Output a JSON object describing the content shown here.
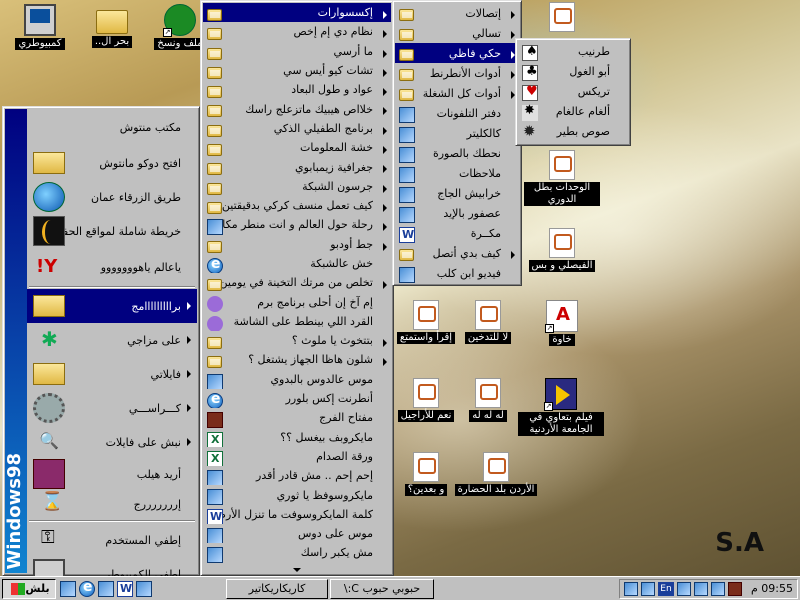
{
  "watermark": "S.A",
  "desktop_icons": [
    {
      "label": "كمبيوطري",
      "icon": "computer-icon"
    },
    {
      "label": "بحر ال..",
      "icon": "folder-icon"
    },
    {
      "label": "ملف ونسخ",
      "icon": "green-ball-icon"
    },
    {
      "label": "الوحدات بطل الدوري",
      "icon": "document-icon"
    },
    {
      "label": "الفيصلي و بس",
      "icon": "document-icon"
    },
    {
      "label": "إقرأ واستمتع",
      "icon": "document-icon"
    },
    {
      "label": "لا للتدخين",
      "icon": "document-icon"
    },
    {
      "label": "خاوة",
      "icon": "acrobat-icon"
    },
    {
      "label": "نعم للأراجيل",
      "icon": "document-icon"
    },
    {
      "label": "له له له",
      "icon": "document-icon"
    },
    {
      "label": "فيلم بتعاوي في الجامعة الأردنية",
      "icon": "film-icon"
    },
    {
      "label": "و بعدين؟",
      "icon": "document-icon"
    },
    {
      "label": "الأردن بلد الحضارة",
      "icon": "document-icon"
    }
  ],
  "start_menu": {
    "banner": "Windows98",
    "items": [
      {
        "label": "مكتب منتوش",
        "icon": "office-icon"
      },
      {
        "label": "افتح دوكو مانتوش",
        "icon": "folder-icon"
      },
      {
        "label": "طريق الزرقاء عمان",
        "icon": "globe-icon"
      },
      {
        "label": "خريطة شاملة لمواقع الحفرتل",
        "icon": "dark-icon"
      },
      {
        "label": "ياعالم ياهووووووو",
        "icon": "yahoo-icon"
      },
      {
        "label": "برااااااااامج",
        "icon": "programs-icon"
      },
      {
        "label": "على مزاجي",
        "icon": "star-icon"
      },
      {
        "label": "فايلاتي",
        "icon": "folder-icon"
      },
      {
        "label": "كـــراســـي",
        "icon": "settings-icon"
      },
      {
        "label": "نبش على فايلات",
        "icon": "find-icon"
      },
      {
        "label": "أريد هيلب",
        "icon": "help-icon"
      },
      {
        "label": "إرررررررج",
        "icon": "run-icon"
      },
      {
        "label": "إطفي المستخدم",
        "icon": "logoff-icon"
      },
      {
        "label": "إطفي الكمبيوطر",
        "icon": "shutdown-icon"
      }
    ]
  },
  "programs_menu": {
    "items": [
      {
        "label": "إكسسوارات",
        "icon": "folder",
        "submenu": true,
        "selected": true
      },
      {
        "label": "نظام دي إم إخص",
        "icon": "folder",
        "submenu": true
      },
      {
        "label": "ما أرسي",
        "icon": "folder",
        "submenu": true
      },
      {
        "label": "تشات كيو أيس سي",
        "icon": "folder",
        "submenu": true
      },
      {
        "label": "عواد و طول البعاد",
        "icon": "folder",
        "submenu": true
      },
      {
        "label": "خلااص هيبيك ماتزعلج راسك",
        "icon": "folder",
        "submenu": true
      },
      {
        "label": "برنامج الطفيلي الذكي",
        "icon": "folder",
        "submenu": true
      },
      {
        "label": "خشة المعلومات",
        "icon": "folder",
        "submenu": true
      },
      {
        "label": "جغرافية زيمبابوي",
        "icon": "folder",
        "submenu": true
      },
      {
        "label": "جرسون الشبكة",
        "icon": "folder",
        "submenu": true
      },
      {
        "label": "كيف تعمل منسف كركي بدقيقتين",
        "icon": "folder",
        "submenu": true
      },
      {
        "label": "رحلة حول العالم و انت منطر مكانك",
        "icon": "app",
        "submenu": true
      },
      {
        "label": "جط أودبو",
        "icon": "folder",
        "submenu": true
      },
      {
        "label": "خش عالشبكة",
        "icon": "ie",
        "submenu": false
      },
      {
        "label": "تخلص من مرتك التخينة في يومين",
        "icon": "folder",
        "submenu": true
      },
      {
        "label": "إم آخ إن أحلى برنامج برم",
        "icon": "fig",
        "submenu": false
      },
      {
        "label": "القرد اللي بينطط على الشاشة",
        "icon": "fig",
        "submenu": false
      },
      {
        "label": "بتتخوث يا ملوث ؟",
        "icon": "folder",
        "submenu": true
      },
      {
        "label": "شلون هاظا الجهاز يشتغل ؟",
        "icon": "folder",
        "submenu": true
      },
      {
        "label": "موس عالدوس بالبدوي",
        "icon": "app",
        "submenu": false
      },
      {
        "label": "أنطرنت إكس بلورر",
        "icon": "ie",
        "submenu": false
      },
      {
        "label": "مفتاح الفرج",
        "icon": "key",
        "submenu": false
      },
      {
        "label": "مايكروبف بيغسل ؟؟",
        "icon": "xl",
        "submenu": false
      },
      {
        "label": "ورقة الصدام",
        "icon": "xl",
        "submenu": false
      },
      {
        "label": "إحم إحم .. مش قادر أقدر",
        "icon": "app",
        "submenu": false
      },
      {
        "label": "مايكروسوفظ يا ثوري",
        "icon": "app",
        "submenu": false
      },
      {
        "label": "كلمة المايكروسوفت ما تنزل الأرض",
        "icon": "word",
        "submenu": false
      },
      {
        "label": "موس على دوس",
        "icon": "app",
        "submenu": false
      },
      {
        "label": "مش يكبر راسك",
        "icon": "app",
        "submenu": false
      }
    ]
  },
  "accessories_menu": {
    "items": [
      {
        "label": "إتصالات",
        "icon": "folder",
        "submenu": true
      },
      {
        "label": "تسالي",
        "icon": "folder",
        "submenu": true
      },
      {
        "label": "حكي فاظي",
        "icon": "folder",
        "submenu": true,
        "selected": true
      },
      {
        "label": "أدوات الأنطرنط",
        "icon": "folder",
        "submenu": true
      },
      {
        "label": "أدوات كل الشغلة",
        "icon": "folder",
        "submenu": true
      },
      {
        "label": "دفتر التلفونات",
        "icon": "app",
        "submenu": false
      },
      {
        "label": "كالكليتر",
        "icon": "app",
        "submenu": false
      },
      {
        "label": "نحطك بالصورة",
        "icon": "app",
        "submenu": false
      },
      {
        "label": "ملاحظات",
        "icon": "app",
        "submenu": false
      },
      {
        "label": "خرابيش الجاج",
        "icon": "app",
        "submenu": false
      },
      {
        "label": "عصفور بالإيد",
        "icon": "app",
        "submenu": false
      },
      {
        "label": "مكــرة",
        "icon": "word",
        "submenu": false
      },
      {
        "label": "كيف بدي أتصل",
        "icon": "folder",
        "submenu": true
      },
      {
        "label": "فيديو ابن كلب",
        "icon": "app",
        "submenu": false
      }
    ]
  },
  "games_menu": {
    "items": [
      {
        "label": "طرنيب",
        "icon": "spade"
      },
      {
        "label": "أبو الغول",
        "icon": "club"
      },
      {
        "label": "تريكس",
        "icon": "heart"
      },
      {
        "label": "ألغام عالغام",
        "icon": "mine"
      },
      {
        "label": "صوص بطير",
        "icon": "spark"
      }
    ]
  },
  "taskbar": {
    "start_label": "بلش",
    "tasks": [
      "كاريكاريكاتير",
      "حبوبي حبوب C:\\"
    ],
    "clock": "09:55 م",
    "lang": "En"
  }
}
